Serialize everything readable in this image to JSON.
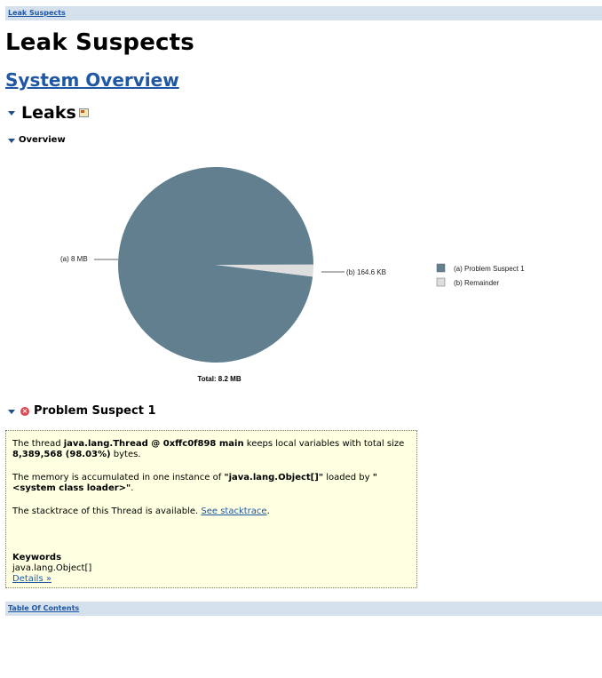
{
  "breadcrumb_top": "Leak Suspects",
  "page_title": "Leak Suspects",
  "system_overview_link": "System Overview",
  "leaks_section": {
    "title": "Leaks"
  },
  "overview_section": {
    "title": "Overview"
  },
  "chart_data": {
    "type": "pie",
    "slices": [
      {
        "label": "(a)",
        "value_label": "8 MB",
        "value_bytes": 8389568,
        "legend": "Problem Suspect 1",
        "color": "#617f8e"
      },
      {
        "label": "(b)",
        "value_label": "164.6 KB",
        "value_bytes": 168550,
        "legend": "Remainder",
        "color": "#dedede"
      }
    ],
    "legend_entries": [
      "(a)  Problem Suspect 1",
      "(b)  Remainder"
    ],
    "slice_labels": [
      "(a)  8 MB",
      "(b)  164.6 KB"
    ],
    "total_label": "Total: 8.2 MB",
    "legend_position": "right"
  },
  "problem_suspect": {
    "title": "Problem Suspect 1",
    "line1_pre": "The thread ",
    "line1_thread": "java.lang.Thread @ 0xffc0f898 main",
    "line1_mid": " keeps local variables with total size ",
    "line1_size": "8,389,568 (98.03%)",
    "line1_post": " bytes.",
    "line2_pre": "The memory is accumulated in one instance of ",
    "line2_class": "\"java.lang.Object[]\"",
    "line2_mid": " loaded by ",
    "line2_loader": "\"<system class loader>\"",
    "line2_post": ".",
    "line3_pre": "The stacktrace of this Thread is available. ",
    "line3_link": "See stacktrace",
    "line3_post": ".",
    "keywords_label": "Keywords",
    "keywords_value": "java.lang.Object[]",
    "details_link": "Details »"
  },
  "breadcrumb_bottom": "Table Of Contents"
}
